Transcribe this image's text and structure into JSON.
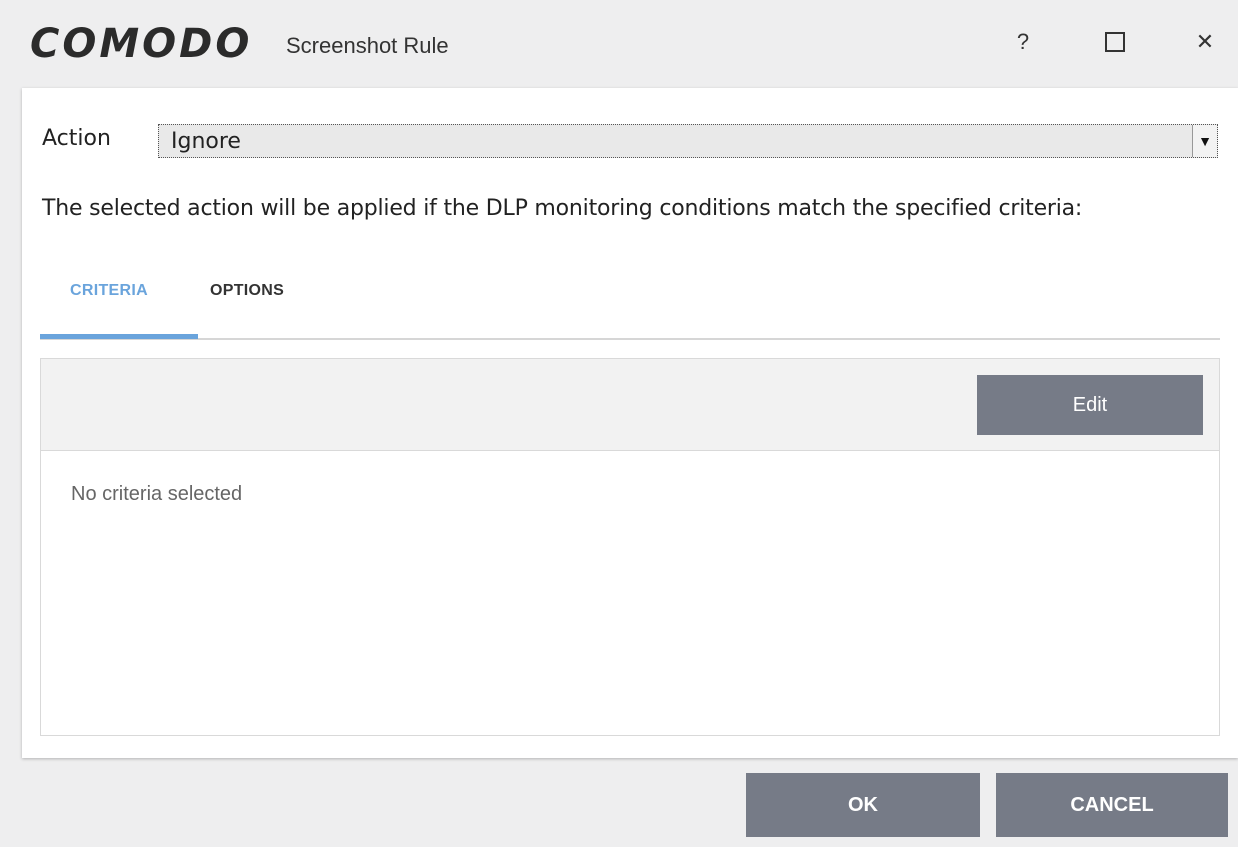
{
  "titlebar": {
    "logo_text": "COMODO",
    "title": "Screenshot Rule",
    "help_label": "?",
    "close_label": "✕"
  },
  "form": {
    "action_label": "Action",
    "action_value": "Ignore",
    "description": "The selected action will be applied if the DLP monitoring conditions match the specified criteria:"
  },
  "tabs": [
    {
      "label": "CRITERIA",
      "active": true
    },
    {
      "label": "OPTIONS",
      "active": false
    }
  ],
  "criteria": {
    "edit_label": "Edit",
    "empty_message": "No criteria selected"
  },
  "footer": {
    "ok_label": "OK",
    "cancel_label": "CANCEL"
  },
  "colors": {
    "accent": "#6aa4dc",
    "button": "#767b87"
  }
}
